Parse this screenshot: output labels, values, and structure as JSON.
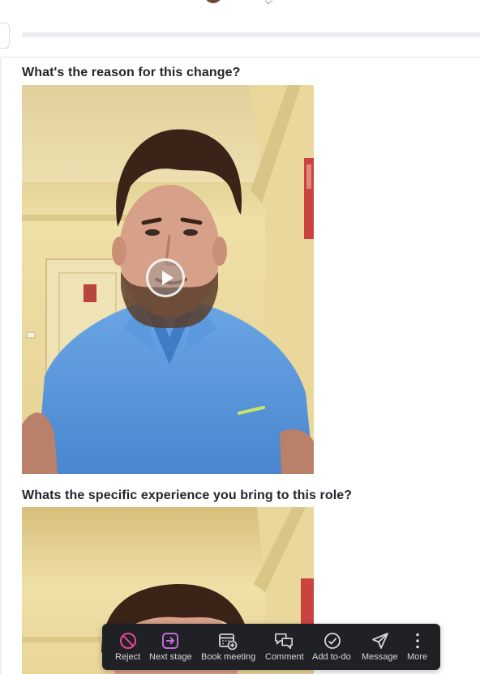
{
  "questions": [
    {
      "text": "What's the reason for this change?"
    },
    {
      "text": "Whats the specific experience you bring to this role?"
    }
  ],
  "video": {
    "play_icon": "play-icon"
  },
  "action_bar": {
    "items": [
      {
        "label": "Reject",
        "icon": "reject-icon",
        "color": "#e6479a"
      },
      {
        "label": "Next stage",
        "icon": "next-stage-icon",
        "color": "#c36bd8"
      },
      {
        "label": "Book meeting",
        "icon": "calendar-icon"
      },
      {
        "label": "Comment",
        "icon": "comment-icon"
      },
      {
        "label": "Add to-do",
        "icon": "todo-check-icon"
      },
      {
        "label": "Message",
        "icon": "send-icon"
      },
      {
        "label": "More",
        "icon": "more-icon"
      }
    ]
  },
  "colors": {
    "text": "#25262b",
    "action_bar_bg": "#202124",
    "reject_accent": "#e6479a",
    "next_stage_accent": "#c36bd8"
  }
}
